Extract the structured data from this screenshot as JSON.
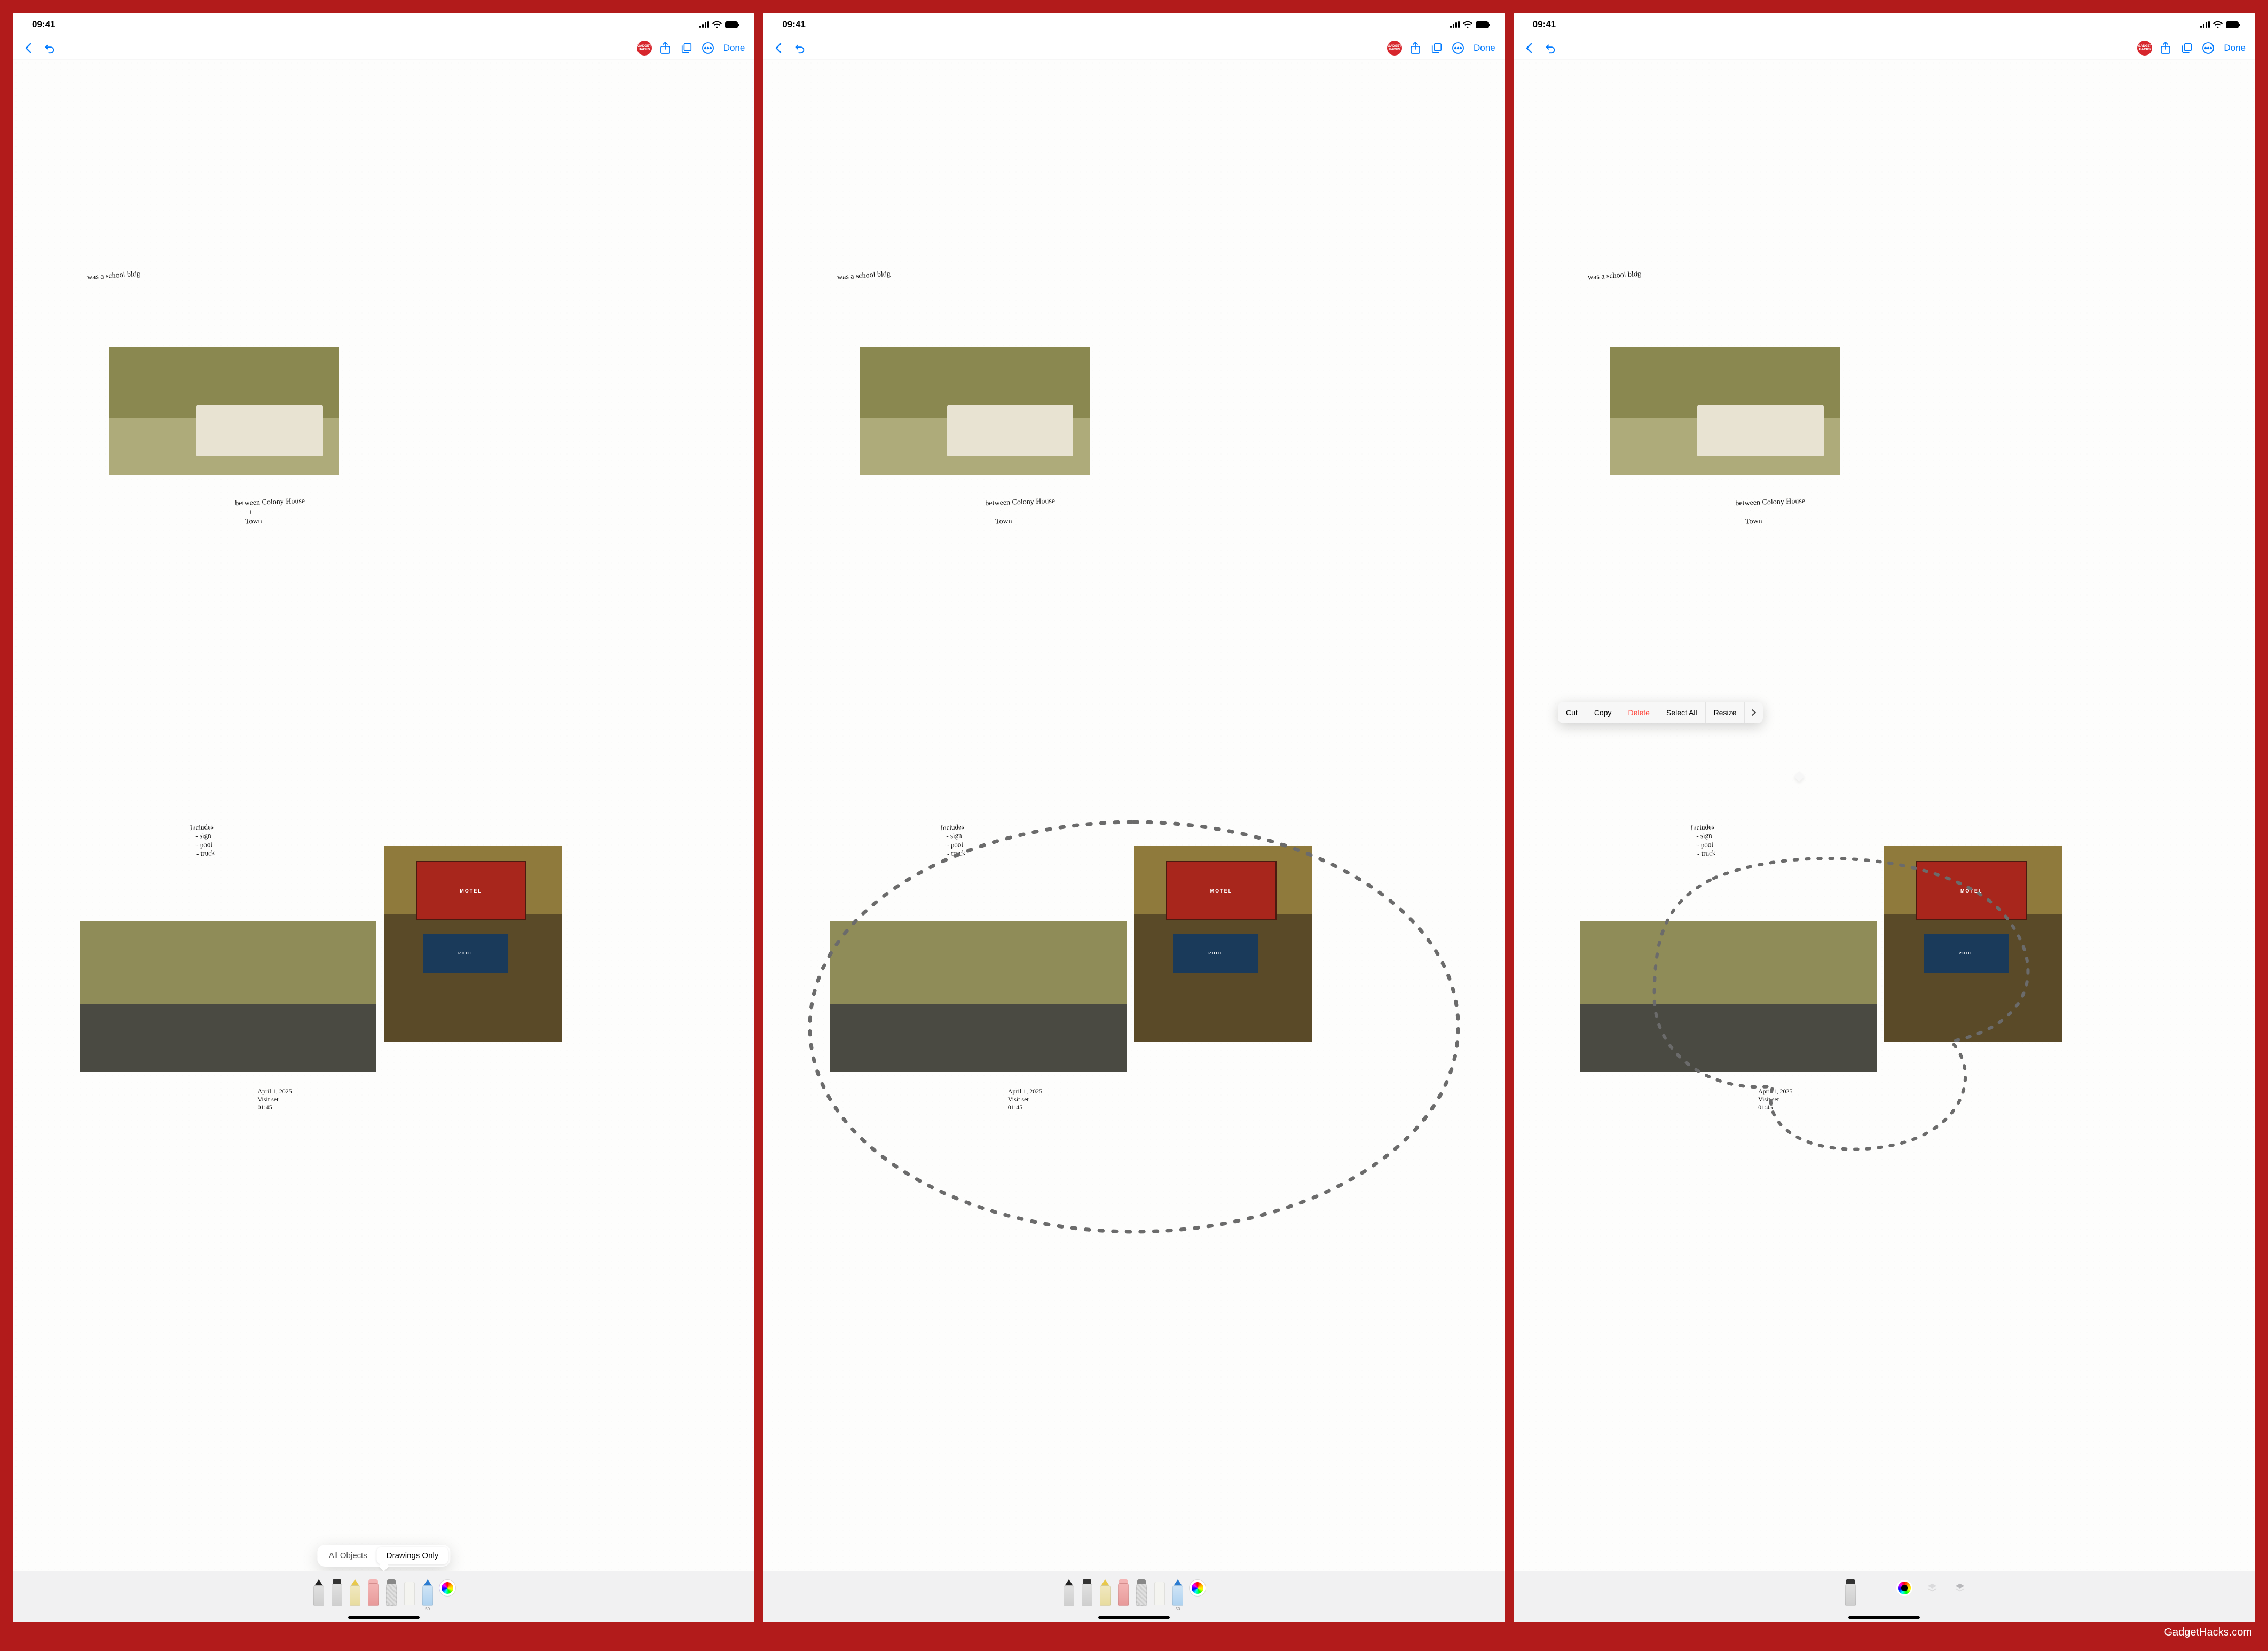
{
  "status": {
    "time": "09:41"
  },
  "nav": {
    "done": "Done",
    "badge": "GADGET HACKS"
  },
  "notes": {
    "hand1": "was a school bldg",
    "hand2": "between Colony House\n       +\n     Town",
    "hand3": "Includes\n   - sign\n   - pool\n   - truck",
    "hand4": "April 1, 2025\nVisit set\n01:45",
    "motel": "MOTEL",
    "pool": "POOL"
  },
  "popover": {
    "all": "All Objects",
    "drawings": "Drawings Only"
  },
  "ctx": {
    "cut": "Cut",
    "copy": "Copy",
    "delete": "Delete",
    "selectall": "Select All",
    "resize": "Resize"
  },
  "tool_label_50": "50",
  "footer": "GadgetHacks.com"
}
